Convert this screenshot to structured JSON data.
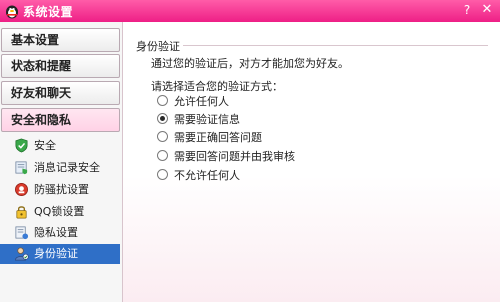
{
  "window": {
    "title": "系统设置",
    "help_label": "?",
    "close_label": "✕"
  },
  "sidebar": {
    "categories": [
      {
        "label": "基本设置"
      },
      {
        "label": "状态和提醒"
      },
      {
        "label": "好友和聊天"
      },
      {
        "label": "安全和隐私"
      }
    ],
    "items": [
      {
        "label": "安全",
        "icon": "shield-icon"
      },
      {
        "label": "消息记录安全",
        "icon": "message-record-icon"
      },
      {
        "label": "防骚扰设置",
        "icon": "anti-harass-icon"
      },
      {
        "label": "QQ锁设置",
        "icon": "qq-lock-icon"
      },
      {
        "label": "隐私设置",
        "icon": "privacy-icon"
      },
      {
        "label": "身份验证",
        "icon": "identity-icon"
      }
    ],
    "selected_item": "身份验证"
  },
  "main": {
    "section_title": "身份验证",
    "description": "通过您的验证后，对方才能加您为好友。",
    "prompt": "请选择适合您的验证方式：",
    "options": [
      {
        "label": "允许任何人",
        "checked": false
      },
      {
        "label": "需要验证信息",
        "checked": true
      },
      {
        "label": "需要正确回答问题",
        "checked": false
      },
      {
        "label": "需要回答问题并由我审核",
        "checked": false
      },
      {
        "label": "不允许任何人",
        "checked": false
      }
    ]
  },
  "colors": {
    "title_bar": "#ee1f86",
    "selected_item": "#2f6fc7"
  }
}
